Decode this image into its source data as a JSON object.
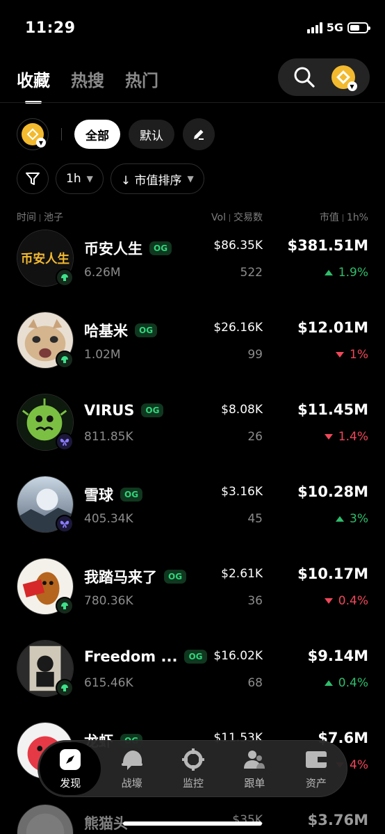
{
  "status_bar": {
    "time": "11:29",
    "network": "5G"
  },
  "top_tabs": [
    {
      "label": "收藏",
      "active": true
    },
    {
      "label": "热搜",
      "active": false
    },
    {
      "label": "热门",
      "active": false
    }
  ],
  "filters": {
    "all_label": "全部",
    "default_label": "默认",
    "timeframe": "1h",
    "sort": "↓ 市值排序"
  },
  "table_header": {
    "left_a": "时间",
    "left_b": "池子",
    "mid_a": "Vol",
    "mid_b": "交易数",
    "right_a": "市值",
    "right_b": "1h%"
  },
  "colors": {
    "up": "#2ebd6b",
    "down": "#f0475a",
    "og": "#2fd67b",
    "bnb": "#f3ba2f"
  },
  "tokens": [
    {
      "name": "币安人生",
      "og": "OG",
      "pool": "6.26M",
      "vol": "$86.35K",
      "txs": "522",
      "mcap": "$381.51M",
      "change": "1.9%",
      "dir": "up",
      "platform": "hand-icon"
    },
    {
      "name": "哈基米",
      "og": "OG",
      "pool": "1.02M",
      "vol": "$26.16K",
      "txs": "99",
      "mcap": "$12.01M",
      "change": "1%",
      "dir": "down",
      "platform": "hand-icon"
    },
    {
      "name": "VIRUS",
      "og": "OG",
      "pool": "811.85K",
      "vol": "$8.08K",
      "txs": "26",
      "mcap": "$11.45M",
      "change": "1.4%",
      "dir": "down",
      "platform": "butterfly-icon"
    },
    {
      "name": "雪球",
      "og": "OG",
      "pool": "405.34K",
      "vol": "$3.16K",
      "txs": "45",
      "mcap": "$10.28M",
      "change": "3%",
      "dir": "up",
      "platform": "butterfly-icon"
    },
    {
      "name": "我踏马来了",
      "og": "OG",
      "pool": "780.36K",
      "vol": "$2.61K",
      "txs": "36",
      "mcap": "$10.17M",
      "change": "0.4%",
      "dir": "down",
      "platform": "hand-icon"
    },
    {
      "name": "Freedom ...",
      "og": "OG",
      "pool": "615.46K",
      "vol": "$16.02K",
      "txs": "68",
      "mcap": "$9.14M",
      "change": "0.4%",
      "dir": "up",
      "platform": "hand-icon"
    },
    {
      "name": "龙虾",
      "og": "OG",
      "pool": "",
      "vol": "$11.53K",
      "txs": "",
      "mcap": "$7.6M",
      "change": "4%",
      "dir": "down",
      "platform": "hand-icon"
    },
    {
      "name": "熊猫头",
      "og": "",
      "pool": "",
      "vol": "$35K",
      "txs": "",
      "mcap": "$3.76M",
      "change": "",
      "dir": "up",
      "platform": ""
    }
  ],
  "avatar_text": {
    "binance_life": "币安人生"
  },
  "bottom_nav": [
    {
      "label": "发现",
      "icon": "compass-icon",
      "active": true
    },
    {
      "label": "战壕",
      "icon": "helmet-icon",
      "active": false
    },
    {
      "label": "监控",
      "icon": "crosshair-icon",
      "active": false
    },
    {
      "label": "跟单",
      "icon": "users-icon",
      "active": false
    },
    {
      "label": "资产",
      "icon": "wallet-icon",
      "active": false
    }
  ]
}
